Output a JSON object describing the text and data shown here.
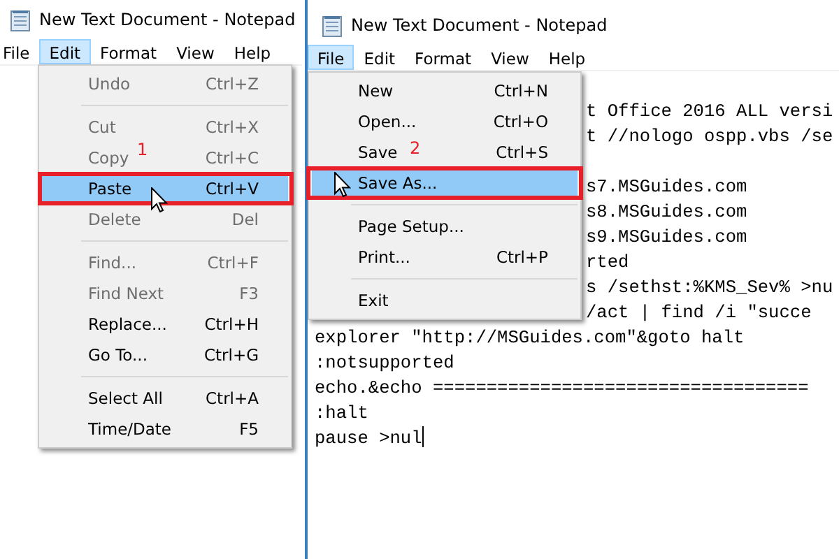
{
  "windows": [
    {
      "title": "New Text Document - Notepad",
      "menu_bar": [
        {
          "label": "File",
          "selected": false
        },
        {
          "label": "Edit",
          "selected": true
        },
        {
          "label": "Format",
          "selected": false
        },
        {
          "label": "View",
          "selected": false
        },
        {
          "label": "Help",
          "selected": false
        }
      ],
      "menu": {
        "items": [
          {
            "kind": "item",
            "label": "Undo",
            "shortcut": "Ctrl+Z",
            "disabled": true,
            "selected": false
          },
          {
            "kind": "separator"
          },
          {
            "kind": "item",
            "label": "Cut",
            "shortcut": "Ctrl+X",
            "disabled": true,
            "selected": false
          },
          {
            "kind": "item",
            "label": "Copy",
            "shortcut": "Ctrl+C",
            "disabled": true,
            "selected": false,
            "annotation": "1"
          },
          {
            "kind": "item",
            "label": "Paste",
            "shortcut": "Ctrl+V",
            "disabled": false,
            "selected": true
          },
          {
            "kind": "item",
            "label": "Delete",
            "shortcut": "Del",
            "disabled": true,
            "selected": false
          },
          {
            "kind": "separator"
          },
          {
            "kind": "item",
            "label": "Find...",
            "shortcut": "Ctrl+F",
            "disabled": true,
            "selected": false
          },
          {
            "kind": "item",
            "label": "Find Next",
            "shortcut": "F3",
            "disabled": true,
            "selected": false
          },
          {
            "kind": "item",
            "label": "Replace...",
            "shortcut": "Ctrl+H",
            "disabled": false,
            "selected": false
          },
          {
            "kind": "item",
            "label": "Go To...",
            "shortcut": "Ctrl+G",
            "disabled": false,
            "selected": false
          },
          {
            "kind": "separator"
          },
          {
            "kind": "item",
            "label": "Select All",
            "shortcut": "Ctrl+A",
            "disabled": false,
            "selected": false
          },
          {
            "kind": "item",
            "label": "Time/Date",
            "shortcut": "F5",
            "disabled": false,
            "selected": false
          }
        ]
      }
    },
    {
      "title": "New Text Document - Notepad",
      "menu_bar": [
        {
          "label": "File",
          "selected": true
        },
        {
          "label": "Edit",
          "selected": false
        },
        {
          "label": "Format",
          "selected": false
        },
        {
          "label": "View",
          "selected": false
        },
        {
          "label": "Help",
          "selected": false
        }
      ],
      "menu": {
        "items": [
          {
            "kind": "item",
            "label": "New",
            "shortcut": "Ctrl+N",
            "disabled": false,
            "selected": false
          },
          {
            "kind": "item",
            "label": "Open...",
            "shortcut": "Ctrl+O",
            "disabled": false,
            "selected": false
          },
          {
            "kind": "item",
            "label": "Save",
            "shortcut": "Ctrl+S",
            "disabled": false,
            "selected": false,
            "annotation": "2"
          },
          {
            "kind": "item",
            "label": "Save As...",
            "disabled": false,
            "selected": true
          },
          {
            "kind": "separator"
          },
          {
            "kind": "item",
            "label": "Page Setup...",
            "disabled": false,
            "selected": false
          },
          {
            "kind": "item",
            "label": "Print...",
            "shortcut": "Ctrl+P",
            "disabled": false,
            "selected": false
          },
          {
            "kind": "separator"
          },
          {
            "kind": "item",
            "label": "Exit",
            "disabled": false,
            "selected": false
          }
        ]
      },
      "editor_lines": [
        {
          "kind": "partial",
          "text": "t Office 2016 ALL versi"
        },
        {
          "kind": "partial",
          "text": "t //nologo ospp.vbs /se"
        },
        {
          "kind": "hidden"
        },
        {
          "kind": "partial",
          "text": "s7.MSGuides.com"
        },
        {
          "kind": "partial",
          "text": "s8.MSGuides.com"
        },
        {
          "kind": "partial",
          "text": "s9.MSGuides.com"
        },
        {
          "kind": "partial",
          "text": "rted"
        },
        {
          "kind": "partial",
          "text": "s /sethst:%KMS_Sev% >nu"
        },
        {
          "kind": "partial",
          "text": "/act | find /i \"succe"
        },
        {
          "kind": "full",
          "text": "explorer \"http://MSGuides.com\"&goto halt"
        },
        {
          "kind": "full",
          "text": ":notsupported"
        },
        {
          "kind": "full",
          "text": "echo.&echo ==================================="
        },
        {
          "kind": "full",
          "text": ":halt"
        },
        {
          "kind": "full",
          "text": "pause >nul",
          "caret": true
        }
      ]
    }
  ]
}
